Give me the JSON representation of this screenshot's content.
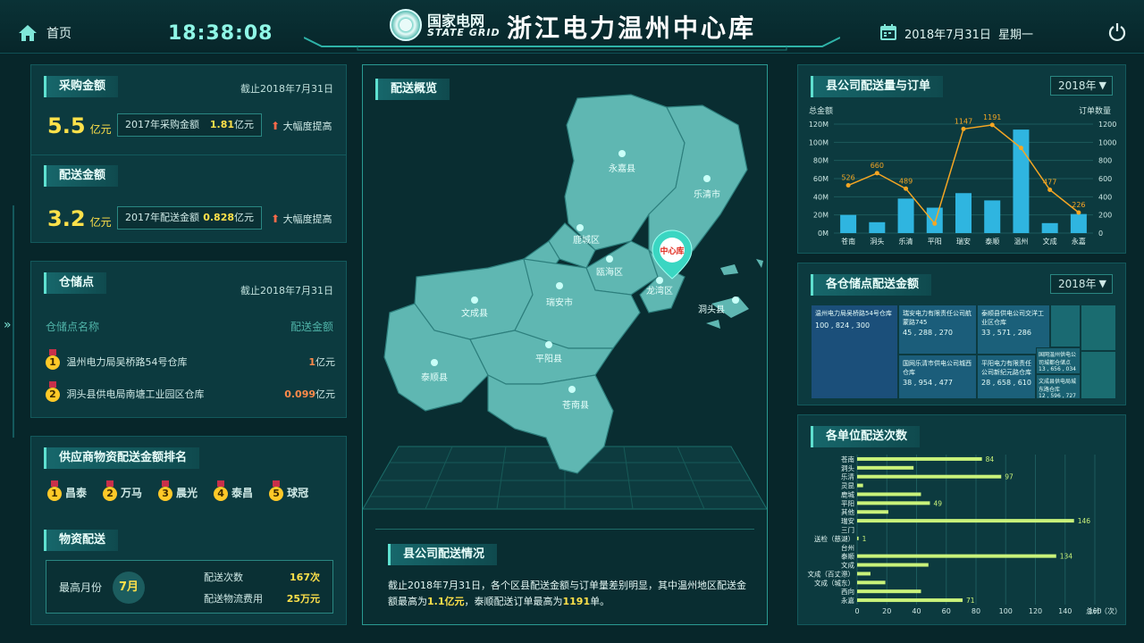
{
  "header": {
    "home_label": "首页",
    "time": "18:38:08",
    "logo_cn": "国家电网",
    "logo_en": "STATE GRID",
    "title": "浙江电力温州中心库",
    "date": "2018年7月31日",
    "weekday": "星期一"
  },
  "purchase": {
    "title": "采购金额",
    "asof": "截止2018年7月31日",
    "value": "5.5",
    "unit": "亿元",
    "compare_label": "2017年采购金额",
    "compare_value": "1.81",
    "compare_unit": "亿元",
    "trend": "大幅度提高"
  },
  "delivery": {
    "title": "配送金额",
    "value": "3.2",
    "unit": "亿元",
    "compare_label": "2017年配送金额",
    "compare_value": "0.828",
    "compare_unit": "亿元",
    "trend": "大幅度提高"
  },
  "warehouse": {
    "title": "仓储点",
    "asof": "截止2018年7月31日",
    "col_name": "仓储点名称",
    "col_amount": "配送金额",
    "rows": [
      {
        "rank": "1",
        "name": "温州电力局吴桥路54号仓库",
        "value": "1",
        "unit": "亿元"
      },
      {
        "rank": "2",
        "name": "洞头县供电局南塘工业园区仓库",
        "value": "0.099",
        "unit": "亿元"
      }
    ]
  },
  "supplier": {
    "title": "供应商物资配送金额排名",
    "items": [
      {
        "rank": "1",
        "name": "昌泰"
      },
      {
        "rank": "2",
        "name": "万马"
      },
      {
        "rank": "3",
        "name": "晨光"
      },
      {
        "rank": "4",
        "name": "泰昌"
      },
      {
        "rank": "5",
        "name": "球冠"
      }
    ]
  },
  "material": {
    "title": "物资配送",
    "peak_label": "最高月份",
    "peak_month": "7月",
    "count_label": "配送次数",
    "count_value": "167次",
    "cost_label": "配送物流费用",
    "cost_value": "25万元"
  },
  "map": {
    "title": "配送概览",
    "center_label": "中心库",
    "regions": [
      "永嘉县",
      "乐清市",
      "鹿城区",
      "瓯海区",
      "龙湾区",
      "洞头县",
      "文成县",
      "瑞安市",
      "平阳县",
      "泰顺县",
      "苍南县"
    ]
  },
  "summary": {
    "title": "县公司配送情况",
    "text_prefix": "截止2018年7月31日，各个区县配送金额与订单量差别明显，其中温州地区配送金额最高为",
    "highlight1": "1.1亿元",
    "text_mid": "，泰顺配送订单最高为",
    "highlight2": "1191",
    "text_suffix": "单。"
  },
  "chart_data": [
    {
      "type": "bar",
      "title": "县公司配送量与订单",
      "year_select": "2018年",
      "ylabel": "总金额",
      "y2label": "订单数量",
      "categories": [
        "苍南",
        "洞头",
        "乐清",
        "平阳",
        "瑞安",
        "泰顺",
        "温州",
        "文成",
        "永嘉"
      ],
      "ylim": [
        0,
        120
      ],
      "y2lim": [
        0,
        1200
      ],
      "yticks": [
        "0M",
        "20M",
        "40M",
        "60M",
        "80M",
        "100M",
        "120M"
      ],
      "y2ticks": [
        "0",
        "200",
        "400",
        "600",
        "800",
        "1000",
        "1200"
      ],
      "series": [
        {
          "values": [
            20,
            12,
            38,
            28,
            44,
            36,
            114,
            11,
            21
          ]
        },
        {
          "values": [
            526,
            660,
            489,
            105,
            1147,
            1191,
            938,
            477,
            226
          ]
        }
      ],
      "line_labels": [
        "526",
        "660",
        "489",
        "",
        "1147",
        "1191",
        "",
        "477",
        "226"
      ]
    },
    {
      "type": "treemap",
      "title": "各仓储点配送金额",
      "year_select": "2018年",
      "items": [
        {
          "name": "温州电力局吴桥路54号仓库",
          "value": "100 , 824 , 300"
        },
        {
          "name": "瑞安电力有限责任公司航蒙路745",
          "value": "45 , 288 , 270"
        },
        {
          "name": "泰顺县供电公司交洋工业区仓库",
          "value": "33 , 571 , 286"
        },
        {
          "name": "国网乐清市供电公司城西仓库",
          "value": "38 , 954 , 477"
        },
        {
          "name": "平阳电力有限责任公司新纪元路仓库",
          "value": "28 , 658 , 610"
        },
        {
          "name": "国网温州供电公司城都仓储点",
          "value": "13 , 656 , 034"
        },
        {
          "name": "文成县供电局城东路仓库",
          "value": "12 , 596 , 727"
        }
      ]
    },
    {
      "type": "bar",
      "orientation": "horizontal",
      "title": "各单位配送次数",
      "xlabel": "总计（次）",
      "xlim": [
        0,
        160
      ],
      "xticks": [
        "0",
        "20",
        "40",
        "60",
        "80",
        "100",
        "120",
        "140",
        "160"
      ],
      "categories": [
        "苍南",
        "洞头",
        "乐清",
        "灵昆",
        "鹿城",
        "平阳",
        "其他",
        "瑞安",
        "三门",
        "送检（慈湖）",
        "台州",
        "泰顺",
        "文成",
        "文成（百丈漈）",
        "文成（城东）",
        "西向",
        "永嘉"
      ],
      "values": [
        84,
        38,
        97,
        4,
        43,
        49,
        21,
        146,
        0,
        1,
        0,
        134,
        48,
        9,
        19,
        43,
        71
      ],
      "labels": [
        "84",
        "",
        "97",
        "",
        "",
        "49",
        "",
        "146",
        "",
        "1",
        "",
        "134",
        "",
        "",
        "",
        "",
        "71"
      ]
    }
  ]
}
